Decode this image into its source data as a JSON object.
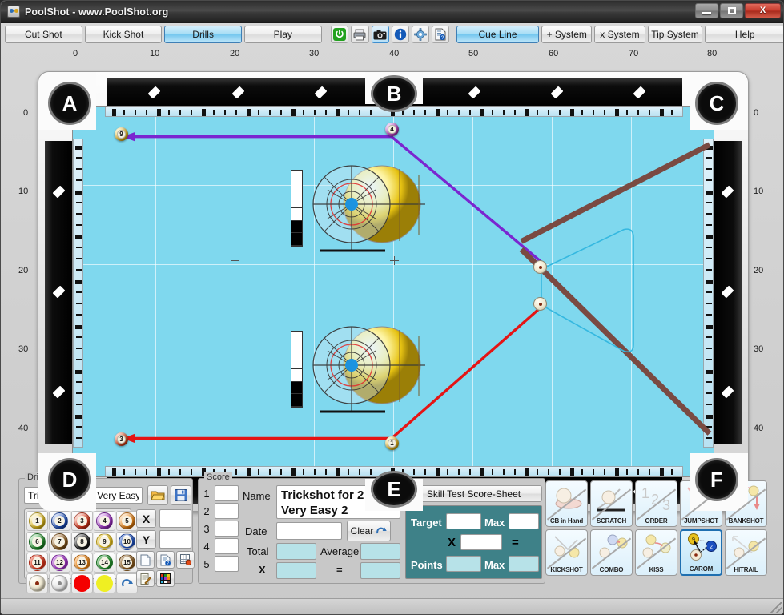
{
  "window": {
    "title": "PoolShot - www.PoolShot.org",
    "icon": "poolshot-app-icon",
    "minimize": "minimize-icon",
    "maximize": "maximize-icon",
    "close": "X"
  },
  "toolbar": {
    "modes": [
      {
        "label": "Cut Shot",
        "active": false
      },
      {
        "label": "Kick Shot",
        "active": false
      },
      {
        "label": "Drills",
        "active": true
      },
      {
        "label": "Play",
        "active": false
      }
    ],
    "icon_buttons": [
      {
        "name": "power-icon",
        "glyph": "⏻",
        "selected": false
      },
      {
        "name": "print-icon",
        "glyph": "⎙",
        "selected": false
      },
      {
        "name": "camera-icon",
        "glyph": "▣",
        "selected": true
      },
      {
        "name": "info-icon",
        "glyph": "i",
        "selected": false
      },
      {
        "name": "settings-gear-icon",
        "glyph": "⚙",
        "selected": false
      },
      {
        "name": "help-document-icon",
        "glyph": "⍰",
        "selected": false
      }
    ],
    "cue_line": "Cue Line",
    "plus_system": "+ System",
    "x_system": "x System",
    "tip_system": "Tip System",
    "help": "Help"
  },
  "table": {
    "x_axis_labels": [
      "0",
      "10",
      "20",
      "30",
      "40",
      "50",
      "60",
      "70",
      "80"
    ],
    "y_axis_labels": [
      "0",
      "10",
      "20",
      "30",
      "40"
    ],
    "pockets": [
      {
        "id": "A",
        "label": "A"
      },
      {
        "id": "B",
        "label": "B"
      },
      {
        "id": "C",
        "label": "C"
      },
      {
        "id": "D",
        "label": "D"
      },
      {
        "id": "E",
        "label": "E"
      },
      {
        "id": "F",
        "label": "F"
      }
    ],
    "balls": [
      {
        "number": "9",
        "color": "#e8b71c",
        "near": "A"
      },
      {
        "number": "4",
        "color": "#b93fc4",
        "near": "B"
      },
      {
        "number": "3",
        "color": "#e0451c",
        "near": "D"
      },
      {
        "number": "1",
        "color": "#e8b71c",
        "near": "E"
      }
    ],
    "cue_balls": 2,
    "lines": [
      {
        "name": "purple-shot-line",
        "color": "#7a26d0"
      },
      {
        "name": "red-shot-line",
        "color": "#e51414"
      },
      {
        "name": "brown-cue-line",
        "color": "#7a4a42"
      },
      {
        "name": "cyan-carom-path",
        "color": "#35b8e0"
      }
    ]
  },
  "drills": {
    "legend": "Drills",
    "name_value": "Trickshot for 2 - Very Easy 2",
    "open_icon": "folder-open-icon",
    "save_icon": "floppy-save-icon",
    "ball_palette": [
      {
        "num": "1",
        "color": "#e9c21d",
        "stripe": false
      },
      {
        "num": "2",
        "color": "#1b4fc0",
        "stripe": false
      },
      {
        "num": "3",
        "color": "#e03418",
        "stripe": false
      },
      {
        "num": "4",
        "color": "#a031c8",
        "stripe": false
      },
      {
        "num": "5",
        "color": "#ef8512",
        "stripe": false
      },
      {
        "num": "6",
        "color": "#1f9128",
        "stripe": false
      },
      {
        "num": "7",
        "color": "#8b5a1b",
        "stripe": false
      },
      {
        "num": "8",
        "color": "#191919",
        "stripe": false
      },
      {
        "num": "9",
        "color": "#e9c21d",
        "stripe": true
      },
      {
        "num": "10",
        "color": "#1b4fc0",
        "stripe": true
      },
      {
        "num": "11",
        "color": "#e03418",
        "stripe": true
      },
      {
        "num": "12",
        "color": "#a031c8",
        "stripe": true
      },
      {
        "num": "13",
        "color": "#ef8512",
        "stripe": true
      },
      {
        "num": "14",
        "color": "#1f9128",
        "stripe": true
      },
      {
        "num": "15",
        "color": "#8b5a1b",
        "stripe": true
      }
    ],
    "special_balls": [
      {
        "name": "cue-ball-red-dot",
        "color": "#f3ecd8"
      },
      {
        "name": "ghost-ball",
        "color": "#e9e9e9"
      },
      {
        "name": "red-marker-ball",
        "color": "#f40000"
      },
      {
        "name": "yellow-marker-ball",
        "color": "#efef22"
      },
      {
        "name": "undo-arrow-icon",
        "color": "#e9f2fa"
      }
    ],
    "x_button": "X",
    "y_button": "Y",
    "x_value": "",
    "y_value": "",
    "tool_icons": [
      {
        "name": "new-page-icon"
      },
      {
        "name": "document-help-icon"
      },
      {
        "name": "table-properties-icon"
      },
      {
        "name": "edit-notes-icon"
      },
      {
        "name": "color-palette-icon"
      }
    ]
  },
  "score": {
    "legend": "Score",
    "rows": [
      "1",
      "2",
      "3",
      "4",
      "5"
    ],
    "row_values": [
      "",
      "",
      "",
      "",
      ""
    ],
    "name_label": "Name",
    "name_value": "Trickshot for 2 - Very Easy 2",
    "date_label": "Date",
    "date_value": "",
    "clear_label": "Clear",
    "clear_icon": "undo-arrow-icon",
    "total_label": "Total",
    "total_value": "",
    "average_label": "Average",
    "average_value": "",
    "x_label": "X",
    "x_value": "",
    "equals_label": "=",
    "equals_value": ""
  },
  "skill_test": {
    "title": "Skill Test Score-Sheet",
    "target_label": "Target",
    "target_value": "",
    "target_max_label": "Max",
    "target_max_value": "",
    "multiply_label": "X",
    "multiply_value": "",
    "equals_label": "=",
    "points_label": "Points",
    "points_value": "",
    "points_max_label": "Max",
    "points_max_value": ""
  },
  "rule_buttons": [
    {
      "label": "CB in Hand",
      "icon": "cue-ball-in-hand-icon",
      "selected": false,
      "disabled": true
    },
    {
      "label": "SCRATCH",
      "icon": "scratch-icon",
      "selected": false,
      "disabled": true
    },
    {
      "label": "ORDER",
      "icon": "order-123-icon",
      "selected": false,
      "disabled": true
    },
    {
      "label": "JUMPSHOT",
      "icon": "jumpshot-icon",
      "selected": false,
      "disabled": true
    },
    {
      "label": "BANKSHOT",
      "icon": "bankshot-icon",
      "selected": false,
      "disabled": true
    },
    {
      "label": "KICKSHOT",
      "icon": "kickshot-icon",
      "selected": false,
      "disabled": true
    },
    {
      "label": "COMBO",
      "icon": "combo-icon",
      "selected": false,
      "disabled": true
    },
    {
      "label": "KISS",
      "icon": "kiss-icon",
      "selected": false,
      "disabled": true
    },
    {
      "label": "CAROM",
      "icon": "carom-icon",
      "selected": true,
      "disabled": false
    },
    {
      "label": "HITRAIL",
      "icon": "hitrail-icon",
      "selected": false,
      "disabled": true
    }
  ]
}
